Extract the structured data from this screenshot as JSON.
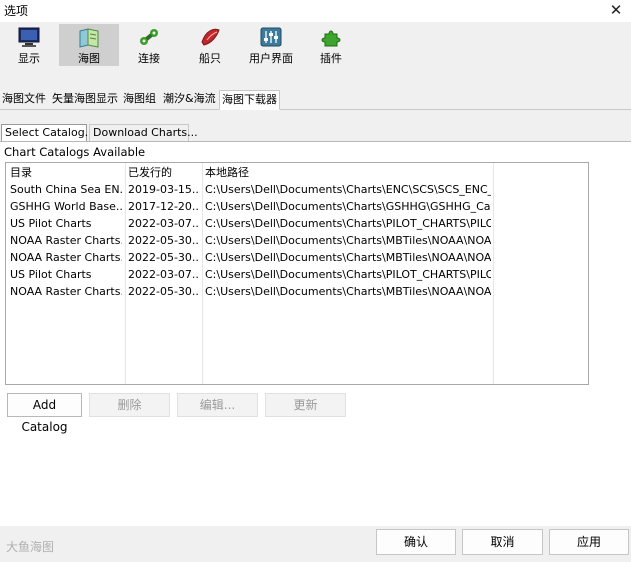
{
  "window": {
    "title": "选项"
  },
  "toolbar": {
    "items": [
      {
        "label": "显示",
        "icon": "monitor-icon"
      },
      {
        "label": "海图",
        "icon": "chart-book-icon"
      },
      {
        "label": "连接",
        "icon": "connection-icon"
      },
      {
        "label": "船只",
        "icon": "ship-icon"
      },
      {
        "label": "用户界面",
        "icon": "sliders-icon"
      },
      {
        "label": "插件",
        "icon": "puzzle-icon"
      }
    ],
    "selected": "海图"
  },
  "tabs": [
    "海图文件",
    "矢量海图显示",
    "海图组",
    "潮汐&海流",
    "海图下载器"
  ],
  "active_tab": "海图下载器",
  "subtabs": [
    "Select Catalog...",
    "Download Charts..."
  ],
  "panel": {
    "section_label": "Chart Catalogs Available",
    "columns": [
      "目录",
      "已发行的",
      "本地路径"
    ],
    "rows": [
      [
        "South China Sea EN...",
        "2019-03-15...",
        "C:\\Users\\Dell\\Documents\\Charts\\ENC\\SCS\\SCS_ENC_C..."
      ],
      [
        "GSHHG World Base...",
        "2017-12-20...",
        "C:\\Users\\Dell\\Documents\\Charts\\GSHHG\\GSHHG_Cat..."
      ],
      [
        "US Pilot Charts",
        "2022-03-07...",
        "C:\\Users\\Dell\\Documents\\Charts\\PILOT_CHARTS\\PILO..."
      ],
      [
        "NOAA Raster Charts...",
        "2022-05-30...",
        "C:\\Users\\Dell\\Documents\\Charts\\MBTiles\\NOAA\\NOA..."
      ],
      [
        "NOAA Raster Charts...",
        "2022-05-30...",
        "C:\\Users\\Dell\\Documents\\Charts\\MBTiles\\NOAA\\NOA..."
      ],
      [
        "US Pilot Charts",
        "2022-03-07...",
        "C:\\Users\\Dell\\Documents\\Charts\\PILOT_CHARTS\\PILO..."
      ],
      [
        "NOAA Raster Charts...",
        "2022-05-30...",
        "C:\\Users\\Dell\\Documents\\Charts\\MBTiles\\NOAA\\NOA..."
      ]
    ],
    "buttons": {
      "add": "Add Catalog",
      "delete": "删除",
      "edit": "编辑...",
      "update": "更新"
    }
  },
  "footer": {
    "watermark": "大鱼海图",
    "ok": "确认",
    "cancel": "取消",
    "apply": "应用"
  }
}
